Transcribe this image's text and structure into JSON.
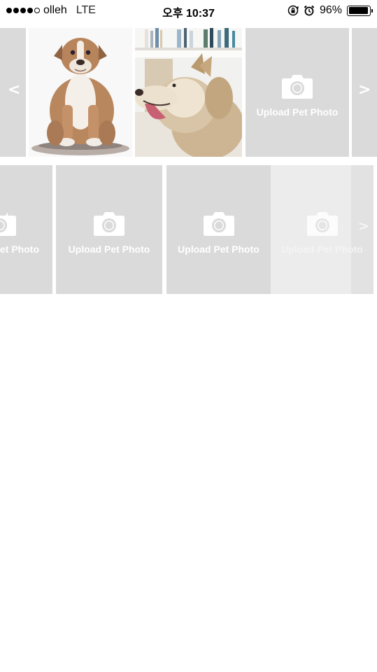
{
  "status_bar": {
    "carrier": "olleh",
    "network": "LTE",
    "time": "오후 10:37",
    "battery_percent": "96%",
    "battery_level": 0.96,
    "signal_bars": 4,
    "signal_max": 5,
    "icons": [
      "rotation-lock-icon",
      "alarm-icon",
      "battery-icon"
    ]
  },
  "carousel_top": {
    "prev_arrow": "<",
    "next_arrow": ">",
    "photos": [
      {
        "subject": "puppy-photo"
      },
      {
        "subject": "husky-photo"
      }
    ],
    "upload_label": "Upload Pet Photo"
  },
  "carousel_bottom": {
    "partial_label": "et Photo",
    "upload_labels": [
      "Upload Pet Photo",
      "Upload Pet Photo",
      "Upload Pet Photo"
    ],
    "next_arrow": ">"
  },
  "colors": {
    "tile_bg": "#dadada",
    "tile_highlight": "#ececec",
    "page_bg": "#ffffff"
  }
}
